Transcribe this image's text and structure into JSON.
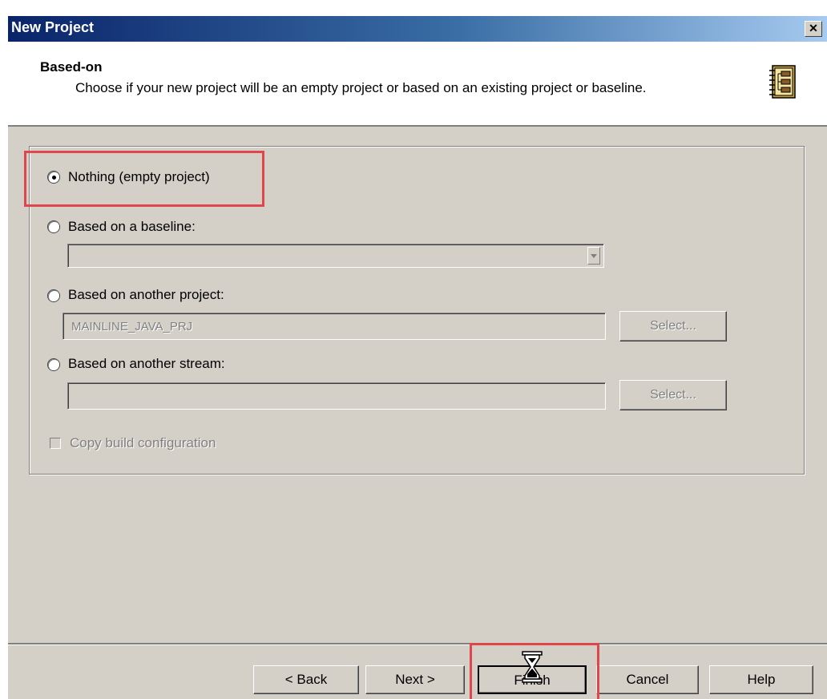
{
  "window": {
    "title": "New Project",
    "close_glyph": "✕"
  },
  "header": {
    "title": "Based-on",
    "description": "Choose if your new project will be an empty project or based on an existing project or baseline.",
    "icon": "wizard-notebook-icon"
  },
  "options": {
    "nothing": {
      "label": "Nothing (empty project)",
      "selected": true
    },
    "baseline": {
      "label": "Based on a baseline:",
      "selected": false,
      "dropdown_value": ""
    },
    "project": {
      "label": "Based on another project:",
      "selected": false,
      "value": "MAINLINE_JAVA_PRJ",
      "select_label": "Select..."
    },
    "stream": {
      "label": "Based on another stream:",
      "selected": false,
      "value": "",
      "select_label": "Select..."
    }
  },
  "copy_build_config": {
    "label": "Copy build configuration",
    "checked": false
  },
  "buttons": {
    "back": "< Back",
    "next": "Next >",
    "finish": "Finish",
    "cancel": "Cancel",
    "help": "Help"
  },
  "colors": {
    "highlight": "#e0474c",
    "titlebar": "#0a246a",
    "dialog_bg": "#d4d0c8"
  }
}
